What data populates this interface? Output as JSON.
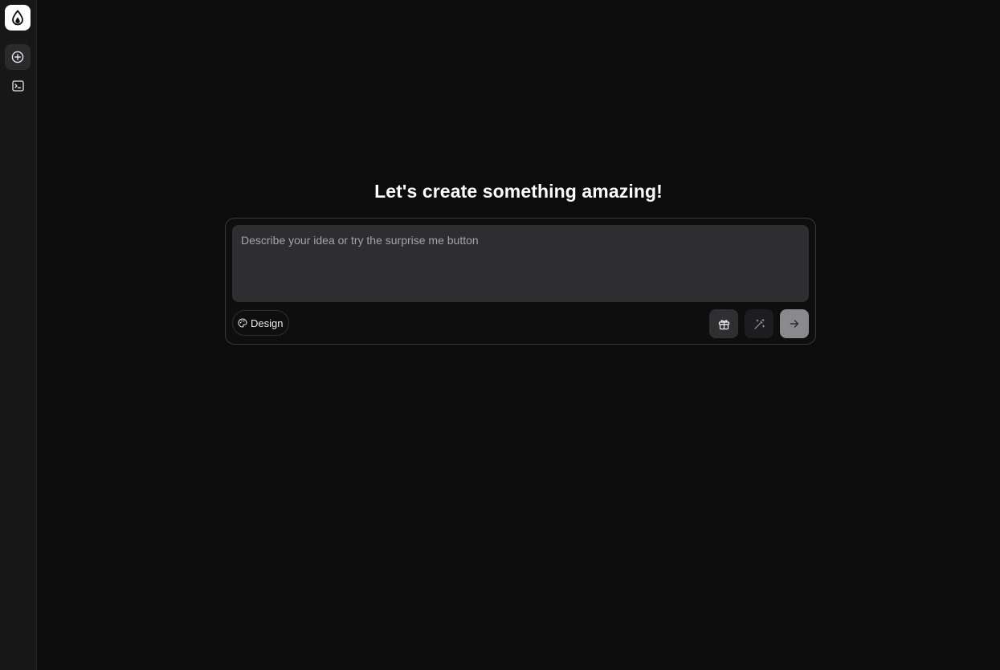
{
  "sidebar": {
    "logo_icon": "drop-icon",
    "items": [
      {
        "name": "new-chat",
        "icon": "plus-circle-icon"
      },
      {
        "name": "terminal",
        "icon": "terminal-icon"
      }
    ]
  },
  "main": {
    "headline": "Let's create something amazing!",
    "prompt": {
      "placeholder": "Describe your idea or try the surprise me button",
      "value": ""
    },
    "design_button": {
      "label": "Design",
      "icon": "palette-icon"
    },
    "actions": [
      {
        "name": "surprise-me",
        "icon": "gift-icon"
      },
      {
        "name": "enhance-prompt",
        "icon": "magic-wand-icon"
      },
      {
        "name": "send",
        "icon": "arrow-right-icon"
      }
    ]
  },
  "colors": {
    "background": "#0c0c0d",
    "sidebar": "#171718",
    "input": "#2e2e30",
    "send_button": "#8a8a8c",
    "text": "#ffffff"
  }
}
